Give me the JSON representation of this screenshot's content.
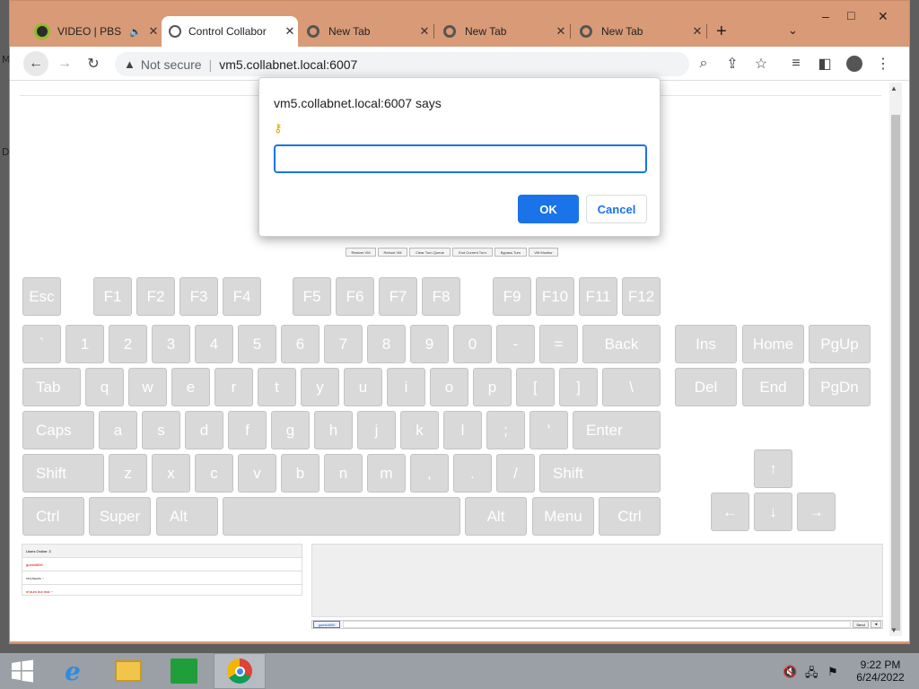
{
  "browser": {
    "tabs": [
      {
        "label": "VIDEO | PBS",
        "active": false
      },
      {
        "label": "Control Collabor",
        "active": true
      },
      {
        "label": "New Tab",
        "active": false
      },
      {
        "label": "New Tab",
        "active": false
      },
      {
        "label": "New Tab",
        "active": false
      }
    ],
    "close_glyph": "✕",
    "new_tab_glyph": "+",
    "not_secure": "Not secure",
    "url": "vm5.collabnet.local:6007",
    "window_controls": {
      "minimize": "–",
      "maximize": "□",
      "close": "✕"
    }
  },
  "dialog": {
    "title": "vm5.collabnet.local:6007 says",
    "ok": "OK",
    "cancel": "Cancel",
    "input_value": ""
  },
  "vm_buttons": [
    "Restore VM",
    "Reboot VM",
    "Clear Turn Queue",
    "End Current Turn",
    "Bypass Turn",
    "VM Monitor"
  ],
  "keyboard": {
    "fn_row": [
      "Esc",
      "F1",
      "F2",
      "F3",
      "F4",
      "F5",
      "F6",
      "F7",
      "F8",
      "F9",
      "F10",
      "F11",
      "F12"
    ],
    "row1": [
      "`",
      "1",
      "2",
      "3",
      "4",
      "5",
      "6",
      "7",
      "8",
      "9",
      "0",
      "-",
      "=",
      "Back"
    ],
    "row2": [
      "Tab",
      "q",
      "w",
      "e",
      "r",
      "t",
      "y",
      "u",
      "i",
      "o",
      "p",
      "[",
      "]",
      "\\"
    ],
    "row3": [
      "Caps",
      "a",
      "s",
      "d",
      "f",
      "g",
      "h",
      "j",
      "k",
      "l",
      ";",
      "'",
      "Enter"
    ],
    "row4": [
      "Shift",
      "z",
      "x",
      "c",
      "v",
      "b",
      "n",
      "m",
      ",",
      ".",
      "/",
      "Shift"
    ],
    "row5": [
      "Ctrl",
      "Super",
      "Alt",
      "",
      "Alt",
      "Menu",
      "Ctrl"
    ],
    "nav": [
      "Ins",
      "Home",
      "PgUp",
      "Del",
      "End",
      "PgDn"
    ],
    "arrows": {
      "up": "↑",
      "left": "←",
      "down": "↓",
      "right": "→"
    }
  },
  "users": {
    "header": "Users Online: 3",
    "list": [
      {
        "name": "guest4690",
        "color": "#cc0000"
      },
      {
        "name": "red-faces ~",
        "color": "#333333"
      },
      {
        "name": "m'dum but real ~",
        "color": "#cc0000"
      }
    ]
  },
  "chat": {
    "username": "guest4690",
    "send": "Send",
    "extra": "◂"
  },
  "taskbar": {
    "apps": [
      "start-icon",
      "internet-explorer-icon",
      "file-explorer-icon",
      "store-icon",
      "chrome-icon"
    ],
    "time": "9:22 PM",
    "date": "6/24/2022"
  }
}
